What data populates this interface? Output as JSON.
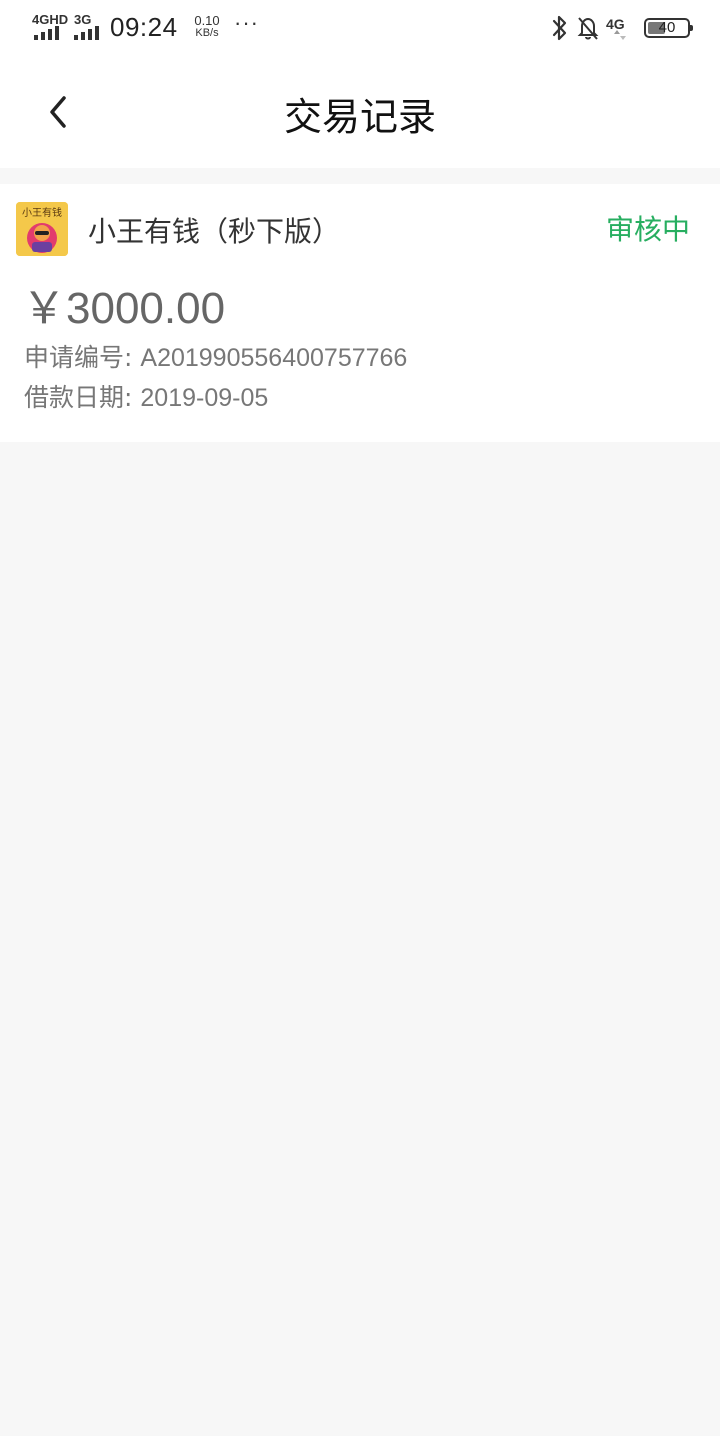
{
  "status_bar": {
    "network1": "4GHD",
    "network2": "3G",
    "time": "09:24",
    "speed_value": "0.10",
    "speed_unit": "KB/s",
    "more": "···",
    "right_network": "4G",
    "battery": "40",
    "battery_level": 0.4
  },
  "nav": {
    "title": "交易记录"
  },
  "record": {
    "app_logo_text": "小王有钱",
    "app_name": "小王有钱（秒下版）",
    "status": "审核中",
    "status_color": "#27ae60",
    "amount": "￥3000.00",
    "application_no_label": "申请编号:",
    "application_no": "A201990556400757766",
    "loan_date_label": "借款日期:",
    "loan_date": "2019-09-05"
  }
}
